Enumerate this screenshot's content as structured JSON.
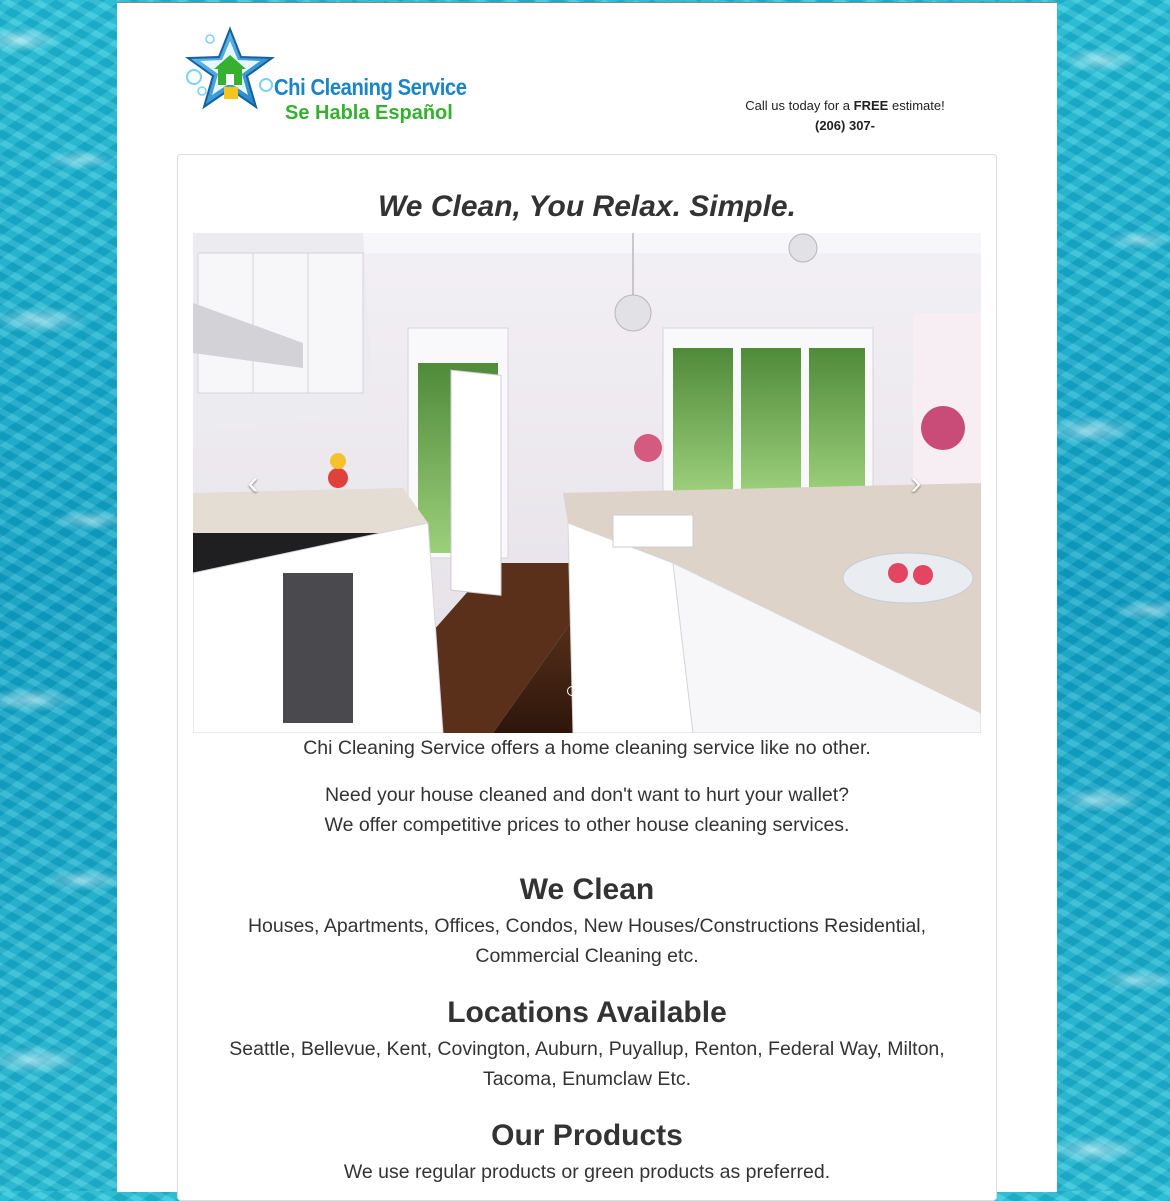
{
  "header": {
    "logo_name": "Chi Cleaning Service",
    "logo_tagline": "Se Habla Español",
    "contact_prefix": "Call us today for a",
    "contact_free": "FREE",
    "contact_suffix": "estimate!",
    "phone": "(206) 307-"
  },
  "main": {
    "headline": "We Clean, You Relax. Simple.",
    "carousel": {
      "prev_icon": "‹",
      "next_icon": "›",
      "slide_count": 3,
      "active_index": 1
    },
    "intro_line": "Chi Cleaning Service offers a home cleaning service like no other.",
    "wallet_line1": "Need your house cleaned and don't want to hurt your wallet?",
    "wallet_line2": "We offer competitive prices to other house cleaning services.",
    "sections": [
      {
        "title": "We Clean",
        "text": "Houses, Apartments, Offices, Condos, New Houses/Constructions Residential, Commercial Cleaning etc."
      },
      {
        "title": "Locations Available",
        "text": "Seattle, Bellevue, Kent, Covington, Auburn, Puyallup, Renton, Federal Way, Milton, Tacoma, Enumclaw Etc."
      },
      {
        "title": "Our Products",
        "text": "We use regular products or green products as preferred."
      }
    ]
  },
  "colors": {
    "brand_blue": "#1b84c7",
    "brand_green": "#35b02f",
    "text": "#333333",
    "water": "#0fa6c8"
  },
  "icons": [
    "star-logo-icon",
    "house-icon",
    "chevron-left-icon",
    "chevron-right-icon"
  ]
}
